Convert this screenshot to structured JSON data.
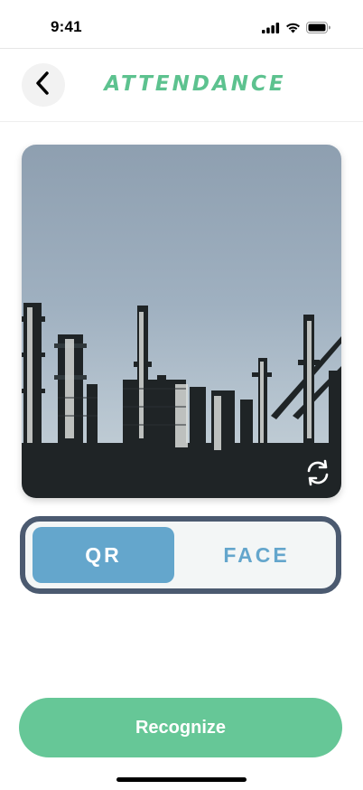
{
  "status_bar": {
    "time": "9:41",
    "icons": [
      "cellular-signal-icon",
      "wifi-icon",
      "battery-icon"
    ]
  },
  "header": {
    "title": "ATTENDANCE",
    "back_icon": "chevron-left-icon"
  },
  "camera": {
    "preview_subject": "industrial refinery towers against grey sky",
    "switch_icon": "switch-camera-icon"
  },
  "mode_toggle": {
    "options": [
      "QR",
      "FACE"
    ],
    "selected": "QR"
  },
  "actions": {
    "recognize_label": "Recognize"
  },
  "colors": {
    "accent_green": "#5dc28f",
    "button_green": "#66c797",
    "toggle_blue": "#64a6cc",
    "toggle_border": "#4b5a70"
  }
}
